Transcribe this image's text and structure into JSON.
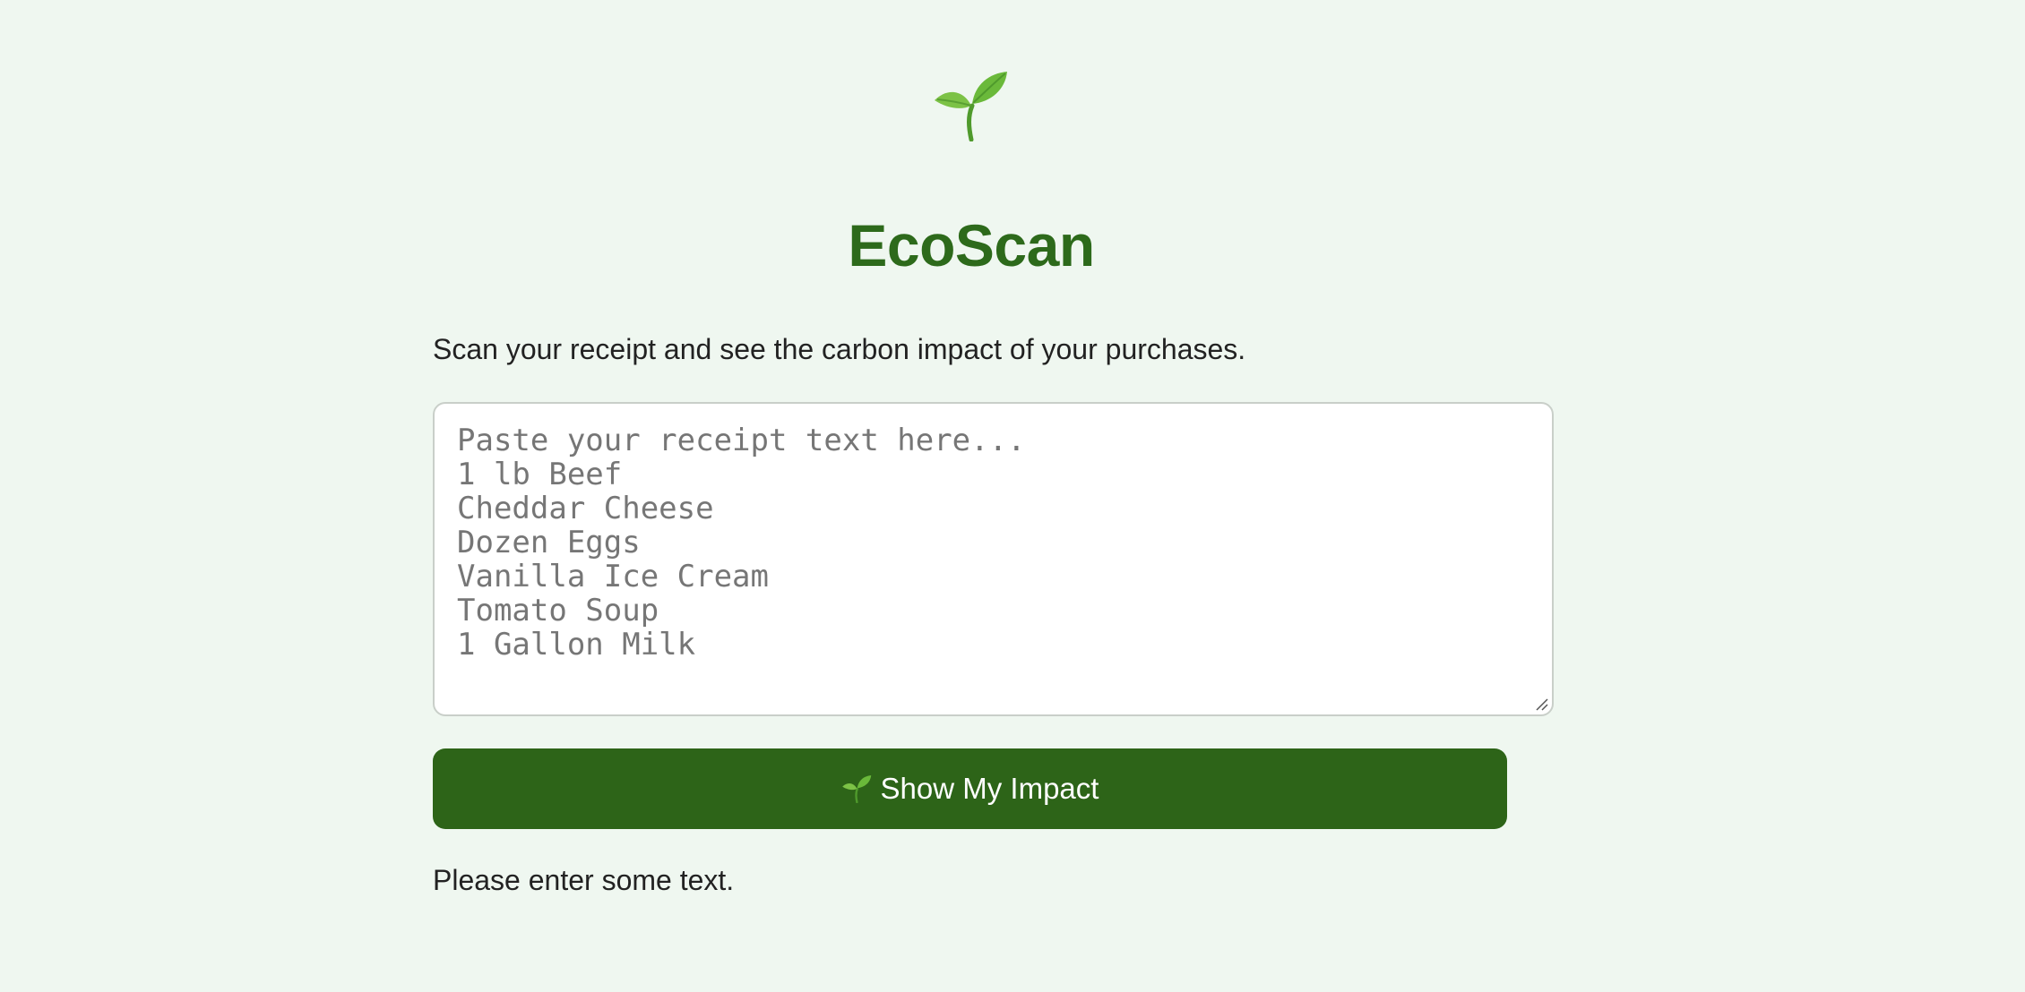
{
  "header": {
    "logo_icon": "seedling-icon",
    "title": "EcoScan",
    "title_color": "#2d6a1b"
  },
  "main": {
    "subtitle": "Scan your receipt and see the carbon impact of your purchases.",
    "receipt_input": {
      "text": "Paste your receipt text here...\n1 lb Beef\nCheddar Cheese\nDozen Eggs\nVanilla Ice Cream\nTomato Soup\n1 Gallon Milk"
    },
    "show_impact_button": {
      "icon": "seedling-icon",
      "label": "Show My Impact",
      "color": "#2d6418"
    },
    "status_message": "Please enter some text."
  },
  "theme": {
    "background": "#eff7f0",
    "accent": "#2d6a1b"
  }
}
